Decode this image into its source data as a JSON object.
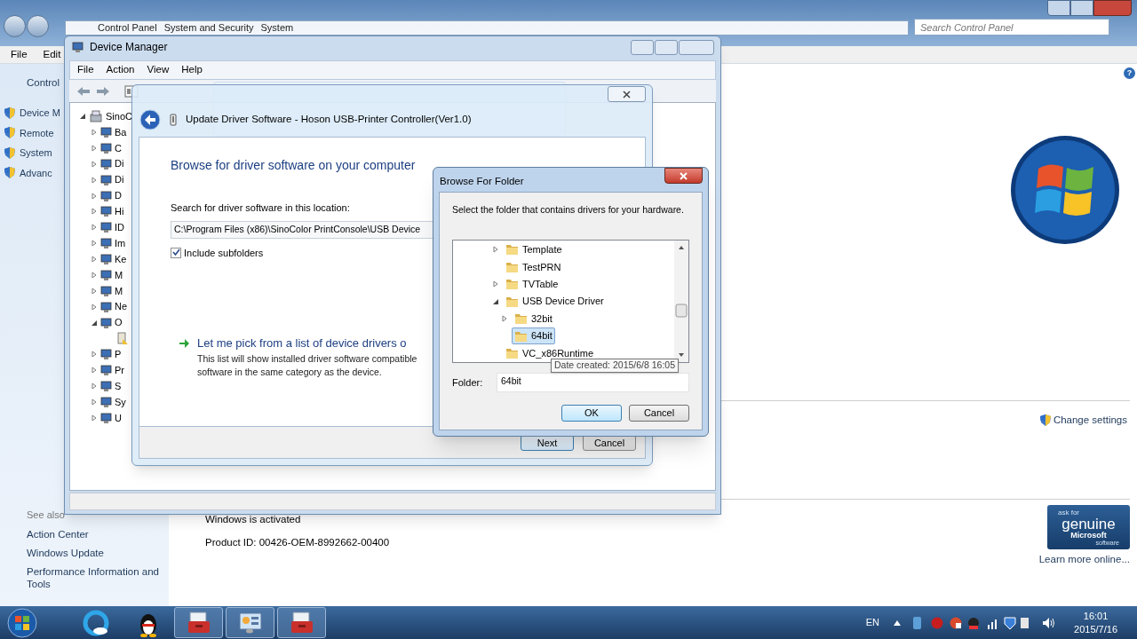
{
  "control_panel": {
    "breadcrumb": [
      "Control Panel",
      "System and Security",
      "System"
    ],
    "search": {
      "placeholder": "Search Control Panel"
    },
    "menu": [
      "File",
      "Edit"
    ],
    "help": "?",
    "tasks": [
      {
        "label": "Control",
        "kind": "link"
      },
      {
        "label": "Device M",
        "kind": "shield-link"
      },
      {
        "label": "Remote",
        "kind": "shield-link"
      },
      {
        "label": "System",
        "kind": "shield-link"
      },
      {
        "label": "Advanc",
        "kind": "shield-link"
      }
    ],
    "see_also": {
      "title": "See also",
      "links": [
        "Action Center",
        "Windows Update",
        "Performance Information and Tools"
      ]
    },
    "activation": {
      "status": "Windows is activated",
      "product_id": "Product ID: 00426-OEM-8992662-00400"
    },
    "change_settings": "Change settings",
    "genuine_badge": {
      "top": "ask for",
      "main": "genuine",
      "brand": "Microsoft",
      "bottom": "software"
    },
    "learn_more": "Learn more online..."
  },
  "device_manager": {
    "title": "Device Manager",
    "menu": [
      "File",
      "Action",
      "View",
      "Help"
    ],
    "tree": {
      "label": "SinoC",
      "expanded": true,
      "children": [
        {
          "label": "Ba",
          "expanded": false
        },
        {
          "label": "C",
          "expanded": false
        },
        {
          "label": "Di",
          "expanded": false
        },
        {
          "label": "Di",
          "expanded": false
        },
        {
          "label": "D",
          "expanded": false
        },
        {
          "label": "Hi",
          "expanded": false
        },
        {
          "label": "ID",
          "expanded": false
        },
        {
          "label": "Im",
          "expanded": false
        },
        {
          "label": "Ke",
          "expanded": false
        },
        {
          "label": "M",
          "expanded": false
        },
        {
          "label": "M",
          "expanded": false
        },
        {
          "label": "Ne",
          "expanded": false
        },
        {
          "label": "O",
          "expanded": true,
          "children": [
            {
              "kind": "warning-device"
            }
          ]
        },
        {
          "label": "P",
          "expanded": false
        },
        {
          "label": "Pr",
          "expanded": false
        },
        {
          "label": "S",
          "expanded": false
        },
        {
          "label": "Sy",
          "expanded": false
        },
        {
          "label": "U",
          "expanded": false
        }
      ]
    }
  },
  "update_driver": {
    "title": "Update Driver Software - Hoson USB-Printer Controller(Ver1.0)",
    "heading": "Browse for driver software on your computer",
    "location_label": "Search for driver software in this location:",
    "location_value": "C:\\Program Files (x86)\\SinoColor PrintConsole\\USB Device",
    "include_subfolders": {
      "label": "Include subfolders",
      "checked": true
    },
    "pick_option": {
      "title": "Let me pick from a list of device drivers o",
      "description": [
        "This list will show installed driver software compatible",
        "software in the same category as the device."
      ]
    },
    "buttons": [
      {
        "label": "Next",
        "default": true
      },
      {
        "label": "Cancel",
        "default": false
      }
    ]
  },
  "browse_folder": {
    "title": "Browse For Folder",
    "instruction": "Select the folder that contains drivers for your hardware.",
    "folders": [
      {
        "label": "Template",
        "expanded": false,
        "selected": false
      },
      {
        "label": "TestPRN",
        "selected": false
      },
      {
        "label": "TVTable",
        "expanded": false,
        "selected": false
      },
      {
        "label": "USB Device Driver",
        "expanded": true,
        "selected": false,
        "children": [
          {
            "label": "32bit",
            "expanded": false,
            "selected": false
          },
          {
            "label": "64bit",
            "selected": true
          }
        ]
      },
      {
        "label": "VC_x86Runtime",
        "selected": false
      }
    ],
    "tooltip": "Date created: 2015/6/8 16:05",
    "folder_label": "Folder:",
    "folder_value": "64bit",
    "buttons": [
      {
        "label": "OK",
        "default": true
      },
      {
        "label": "Cancel",
        "default": false
      }
    ]
  },
  "taskbar": {
    "language": "EN",
    "time": "16:01",
    "date": "2015/7/16"
  }
}
